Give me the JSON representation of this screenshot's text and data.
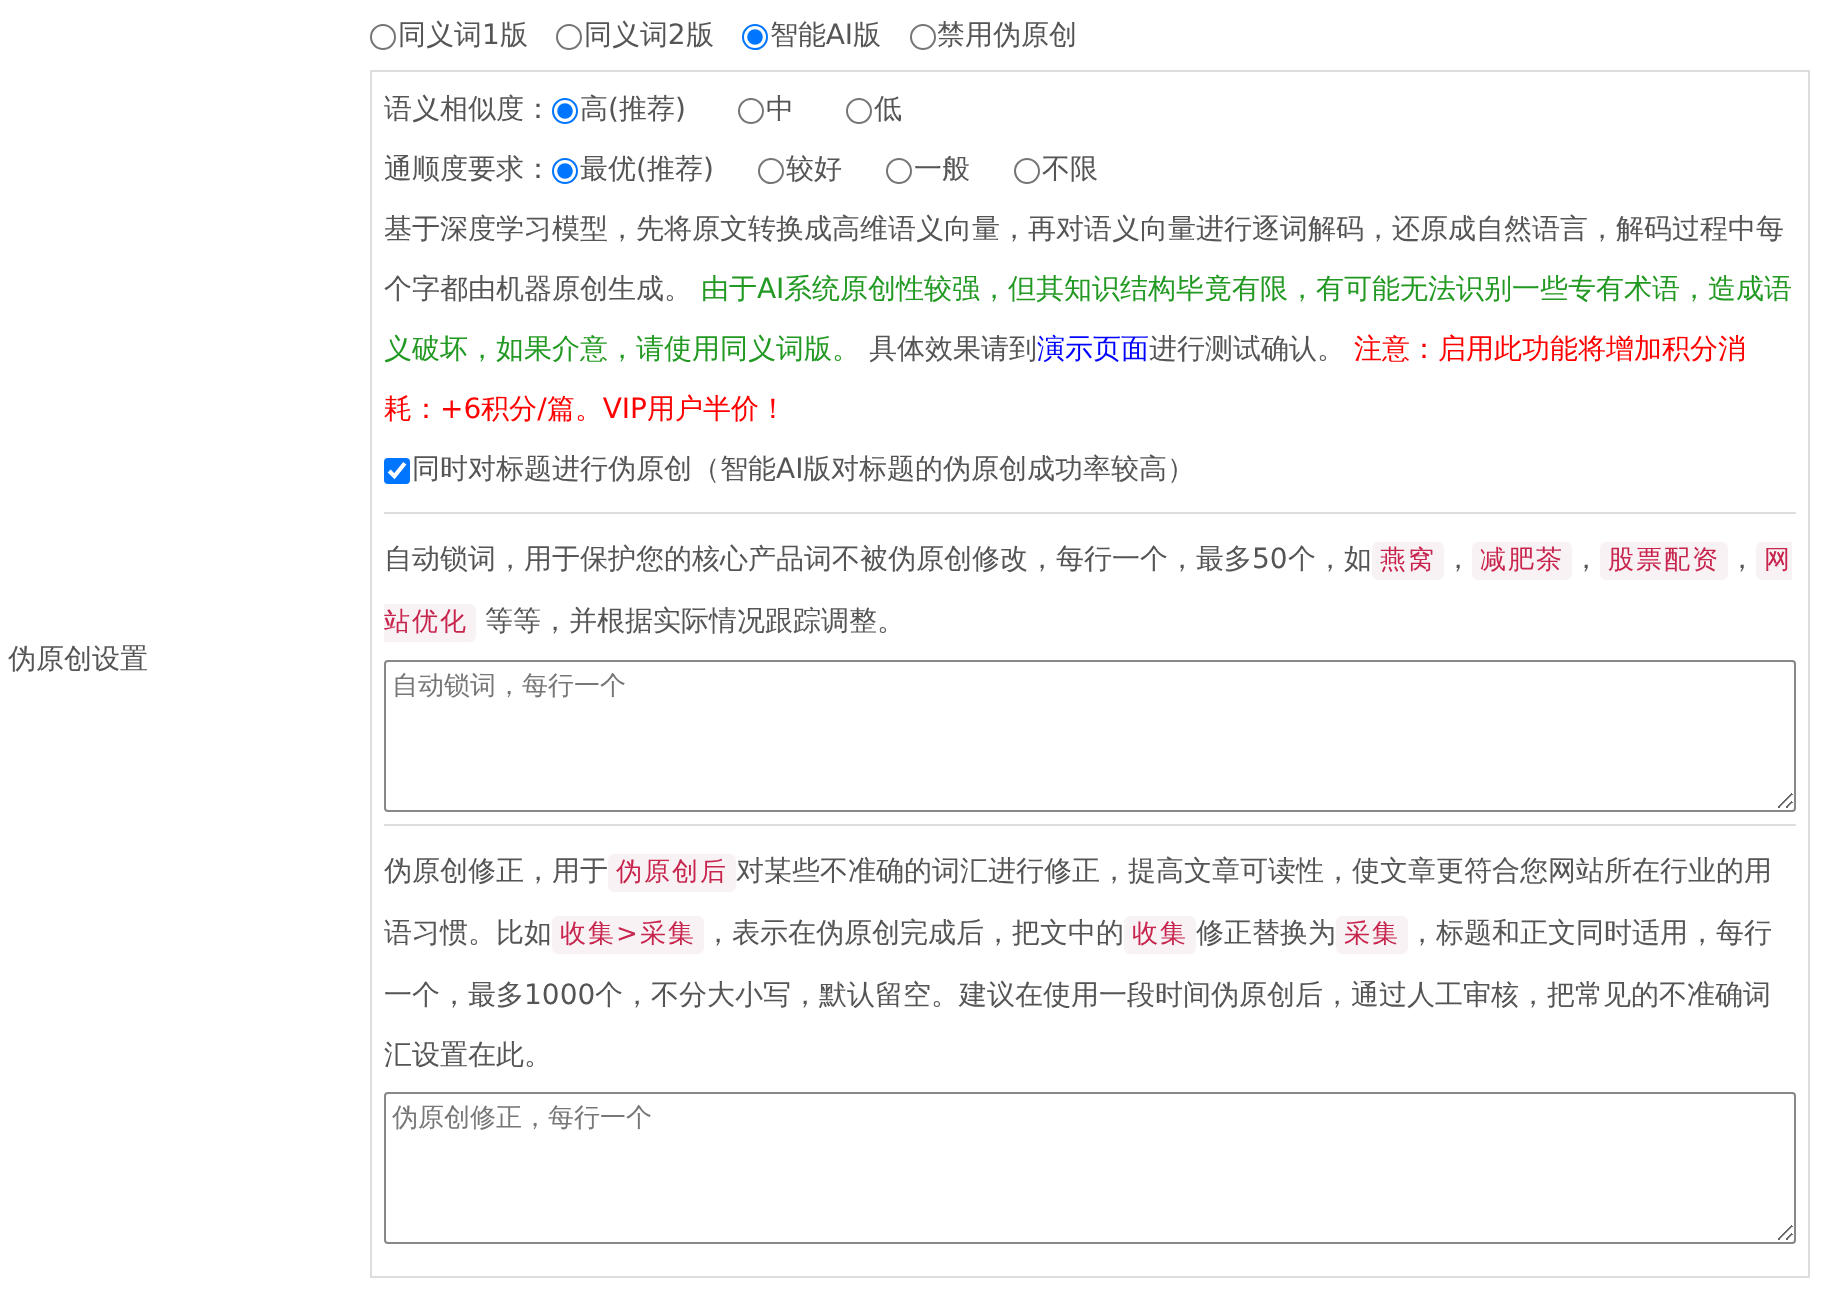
{
  "section_label": "伪原创设置",
  "modes": [
    {
      "label": "同义词1版",
      "selected": false
    },
    {
      "label": "同义词2版",
      "selected": false
    },
    {
      "label": "智能AI版",
      "selected": true
    },
    {
      "label": "禁用伪原创",
      "selected": false
    }
  ],
  "similarity": {
    "label": "语义相似度：",
    "options": [
      {
        "label": "高(推荐)",
        "selected": true
      },
      {
        "label": "中",
        "selected": false
      },
      {
        "label": "低",
        "selected": false
      }
    ]
  },
  "fluency": {
    "label": "通顺度要求：",
    "options": [
      {
        "label": "最优(推荐)",
        "selected": true
      },
      {
        "label": "较好",
        "selected": false
      },
      {
        "label": "一般",
        "selected": false
      },
      {
        "label": "不限",
        "selected": false
      }
    ]
  },
  "description": [
    {
      "kind": "plain",
      "text": "基于深度学习模型，先将原文转换成高维语义向量，再对语义向量进行逐词解码，还原成自然语言，解码过程中每个字都由机器原创生成。 "
    },
    {
      "kind": "success",
      "text": "由于AI系统原创性较强，但其知识结构毕竟有限，有可能无法识别一些专有术语，造成语义破坏，如果介意，请使用同义词版。"
    },
    {
      "kind": "plain",
      "text": " 具体效果请到"
    },
    {
      "kind": "link",
      "text": "演示页面"
    },
    {
      "kind": "plain",
      "text": "进行测试确认。 "
    },
    {
      "kind": "alert",
      "text": "注意：启用此功能将增加积分消耗：+6积分/篇。VIP用户半价！"
    }
  ],
  "title_option": {
    "label": "同时对标题进行伪原创（智能AI版对标题的伪原创成功率较高）",
    "checked": true
  },
  "lock_words": {
    "description": [
      {
        "kind": "plain",
        "text": "自动锁词，用于保护您的核心产品词不被伪原创修改，每行一个，最多50个，如"
      },
      {
        "kind": "tag",
        "text": "燕窝"
      },
      {
        "kind": "plain",
        "text": "，"
      },
      {
        "kind": "tag",
        "text": "减肥茶"
      },
      {
        "kind": "plain",
        "text": "，"
      },
      {
        "kind": "tag",
        "text": "股票配资"
      },
      {
        "kind": "plain",
        "text": "，"
      },
      {
        "kind": "tag",
        "text": "网站优化"
      },
      {
        "kind": "plain",
        "text": " 等等，并根据实际情况跟踪调整。"
      }
    ],
    "placeholder": "自动锁词，每行一个"
  },
  "correction": {
    "description": [
      {
        "kind": "plain",
        "text": "伪原创修正，用于"
      },
      {
        "kind": "tag",
        "text": "伪原创后"
      },
      {
        "kind": "plain",
        "text": "对某些不准确的词汇进行修正，提高文章可读性，使文章更符合您网站所在行业的用语习惯。比如"
      },
      {
        "kind": "tag",
        "text": "收集>采集"
      },
      {
        "kind": "plain",
        "text": "，表示在伪原创完成后，把文中的"
      },
      {
        "kind": "tag",
        "text": "收集"
      },
      {
        "kind": "plain",
        "text": "修正替换为"
      },
      {
        "kind": "tag",
        "text": "采集"
      },
      {
        "kind": "plain",
        "text": "，标题和正文同时适用，每行一个，最多1000个，不分大小写，默认留空。建议在使用一段时间伪原创后，通过人工审核，把常见的不准确词汇设置在此。"
      }
    ],
    "placeholder": "伪原创修正，每行一个"
  }
}
